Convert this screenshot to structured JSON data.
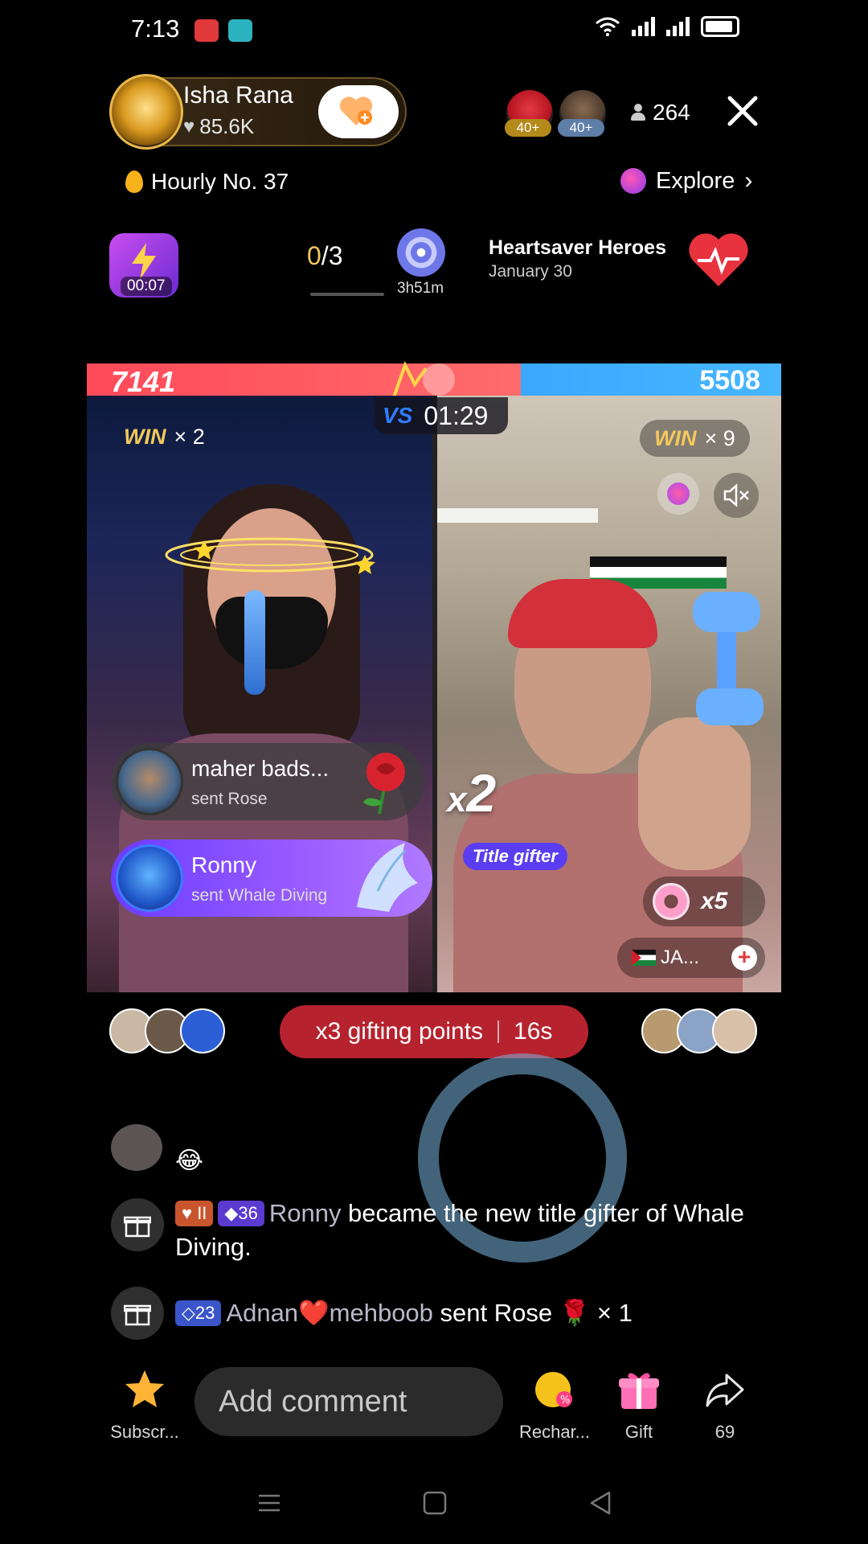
{
  "status_bar": {
    "time": "7:13"
  },
  "host": {
    "name": "Isha Rana",
    "likes": "85.6K"
  },
  "viewers": {
    "badge_1": "40+",
    "badge_2": "40+",
    "count": "264"
  },
  "hourly": {
    "label": "Hourly No. 37"
  },
  "explore": {
    "label": "Explore"
  },
  "events": {
    "bolt_timer": "00:07",
    "task_done": "0",
    "task_total": "/3",
    "target_time": "3h51m",
    "event_title": "Heartsaver Heroes",
    "event_date": "January 30"
  },
  "battle": {
    "score_left": "7141",
    "score_right": "5508",
    "timer": "01:29",
    "vs": "VS",
    "win_word": "WIN",
    "left_wins": "× 2",
    "right_wins": "× 9",
    "combo": "2",
    "combo_prefix": "x",
    "title_gifter": "Title gifter",
    "donut_count": "x5",
    "ja_label": "JA..."
  },
  "gift_toasts": [
    {
      "name": "maher bads...",
      "sub": "sent Rose"
    },
    {
      "name": "Ronny",
      "sub": "sent Whale Diving"
    }
  ],
  "gifting": {
    "label": "x3 gifting points",
    "timer": "16s"
  },
  "chat": {
    "emoji": "😂",
    "messages": [
      {
        "badge_fan": "II",
        "badge_gem": "36",
        "user": "Ronny",
        "text": " became the new title gifter of Whale Diving."
      },
      {
        "badge_diamond": "23",
        "user": "Adnan❤️mehboob",
        "text": " sent Rose 🌹 × 1"
      }
    ]
  },
  "bottom_bar": {
    "subscribe": "Subscr...",
    "comment_placeholder": "Add comment",
    "recharge": "Rechar...",
    "gift": "Gift",
    "share": "69"
  },
  "colors": {
    "score_red": "#ff4a5a",
    "score_blue": "#3aa8ff",
    "win_gold": "#f3c85b",
    "gifting_red": "#b6232f"
  }
}
